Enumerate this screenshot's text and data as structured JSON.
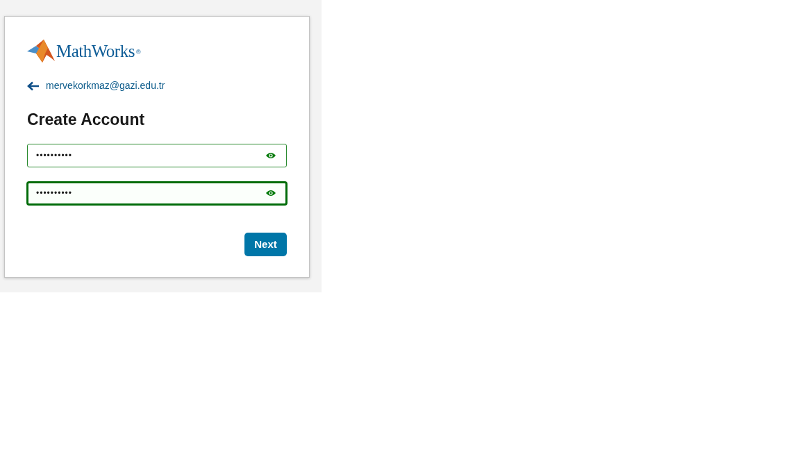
{
  "logo": {
    "wordmark": "MathWorks",
    "mark": "®"
  },
  "account": {
    "email": "mervekorkmaz@gazi.edu.tr"
  },
  "heading": "Create Account",
  "fields": [
    {
      "value": "••••••••••",
      "focused": false
    },
    {
      "value": "••••••••••",
      "focused": true
    }
  ],
  "buttons": [
    "Next"
  ]
}
